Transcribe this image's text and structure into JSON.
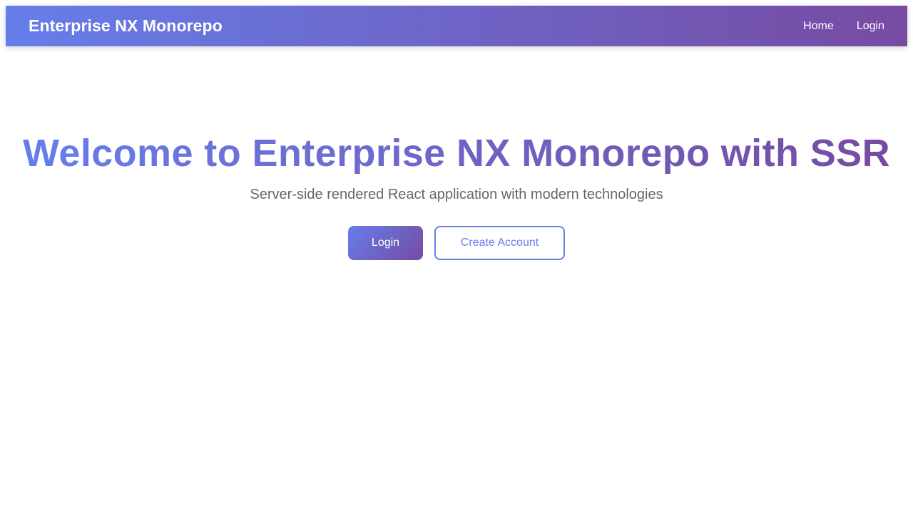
{
  "navbar": {
    "brand": "Enterprise NX Monorepo",
    "links": [
      {
        "label": "Home"
      },
      {
        "label": "Login"
      }
    ]
  },
  "hero": {
    "title": "Welcome to Enterprise NX Monorepo with SSR",
    "subtitle": "Server-side rendered React application with modern technologies",
    "primary_button": "Login",
    "secondary_button": "Create Account"
  },
  "colors": {
    "gradient_start": "#667eea",
    "gradient_end": "#764ba2",
    "subtitle_text": "#666666"
  }
}
